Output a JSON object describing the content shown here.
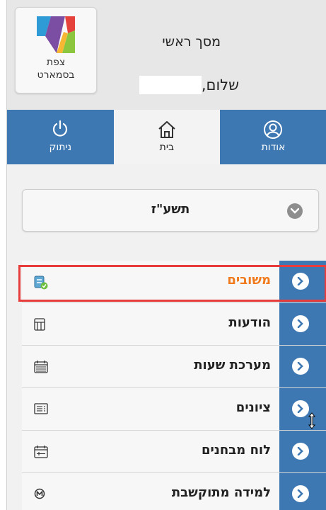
{
  "header": {
    "logo_line1": "צפת",
    "logo_line2": "בסמארט",
    "screen_title": "מסך ראשי",
    "greeting": "שלום,"
  },
  "tabs": [
    {
      "label": "ניתוק",
      "icon": "power-icon"
    },
    {
      "label": "בית",
      "icon": "home-icon"
    },
    {
      "label": "אודות",
      "icon": "person-icon"
    }
  ],
  "year_selector": {
    "label": "תשע\"ז",
    "icon": "chevron-down-icon"
  },
  "menu": {
    "items": [
      {
        "label": "משובים",
        "icon": "feedback-icon",
        "highlighted": true
      },
      {
        "label": "הודעות",
        "icon": "messages-icon"
      },
      {
        "label": "מערכת שעות",
        "icon": "timetable-icon"
      },
      {
        "label": "ציונים",
        "icon": "grades-icon"
      },
      {
        "label": "לוח מבחנים",
        "icon": "exam-calendar-icon"
      },
      {
        "label": "למידה מתוקשבת",
        "icon": "e-learning-icon"
      }
    ]
  },
  "colors": {
    "tab_blue": "#3e78b2",
    "highlight_orange": "#f07a1c",
    "highlight_border": "#e63c3c"
  }
}
